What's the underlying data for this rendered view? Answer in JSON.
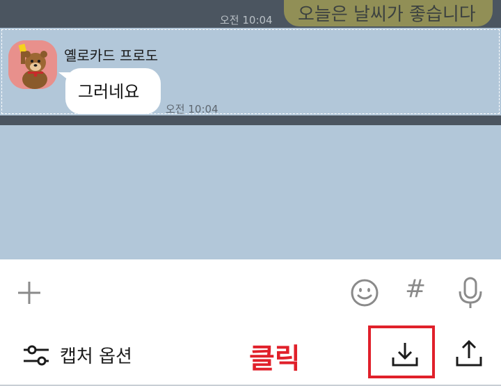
{
  "previous_message": {
    "text": "오늘은 날씨가 좋습니다",
    "time": "오전 10:04"
  },
  "selected_message": {
    "sender": "옐로카드 프로도",
    "text": "그러네요",
    "time": "오전 10:04",
    "avatar_icon": "frodo-avatar-icon"
  },
  "input_bar": {
    "plus_icon": "plus-icon",
    "emoji_icon": "emoji-icon",
    "hash_symbol": "#",
    "mic_icon": "mic-icon"
  },
  "capture_bar": {
    "options_label": "캡처 옵션",
    "annotation": "클릭",
    "download_icon": "download-icon",
    "share_icon": "share-icon"
  },
  "colors": {
    "chat_background": "#b2c7d9",
    "dark_overlay": "#4b5560",
    "annotation_red": "#e0202a"
  }
}
